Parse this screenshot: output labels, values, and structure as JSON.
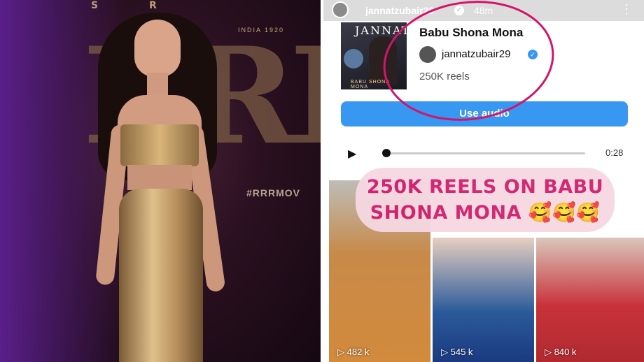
{
  "backdrop": {
    "top_text": "S    R",
    "india_text": "INDIA\n1920",
    "logo_text": "RRR",
    "hashtag": "#RRRMOV"
  },
  "story": {
    "username": "jannatzubair29",
    "time": "48m",
    "more_icon": "more-vertical-icon"
  },
  "audio": {
    "album_art_title": "JANNAT",
    "album_art_subtitle": "BABU SHONA MONA",
    "song_title": "Babu Shona Mona",
    "artist": "jannatzubair29",
    "reels_count": "250K reels",
    "use_audio_label": "Use audio",
    "duration": "0:28",
    "progress": 0.0
  },
  "caption": {
    "line1": "250K REELS ON BABU",
    "line2": "SHONA MONA",
    "emojis": "🥰🥰🥰"
  },
  "reels": [
    {
      "views": "482 k"
    },
    {
      "views": "545 k"
    },
    {
      "views": "840 k"
    }
  ],
  "colors": {
    "accent_blue": "#3897f0",
    "caption_pink": "#d01e6e",
    "bubble_pink": "#f6d8e2",
    "circle_mark": "#d4146a"
  }
}
